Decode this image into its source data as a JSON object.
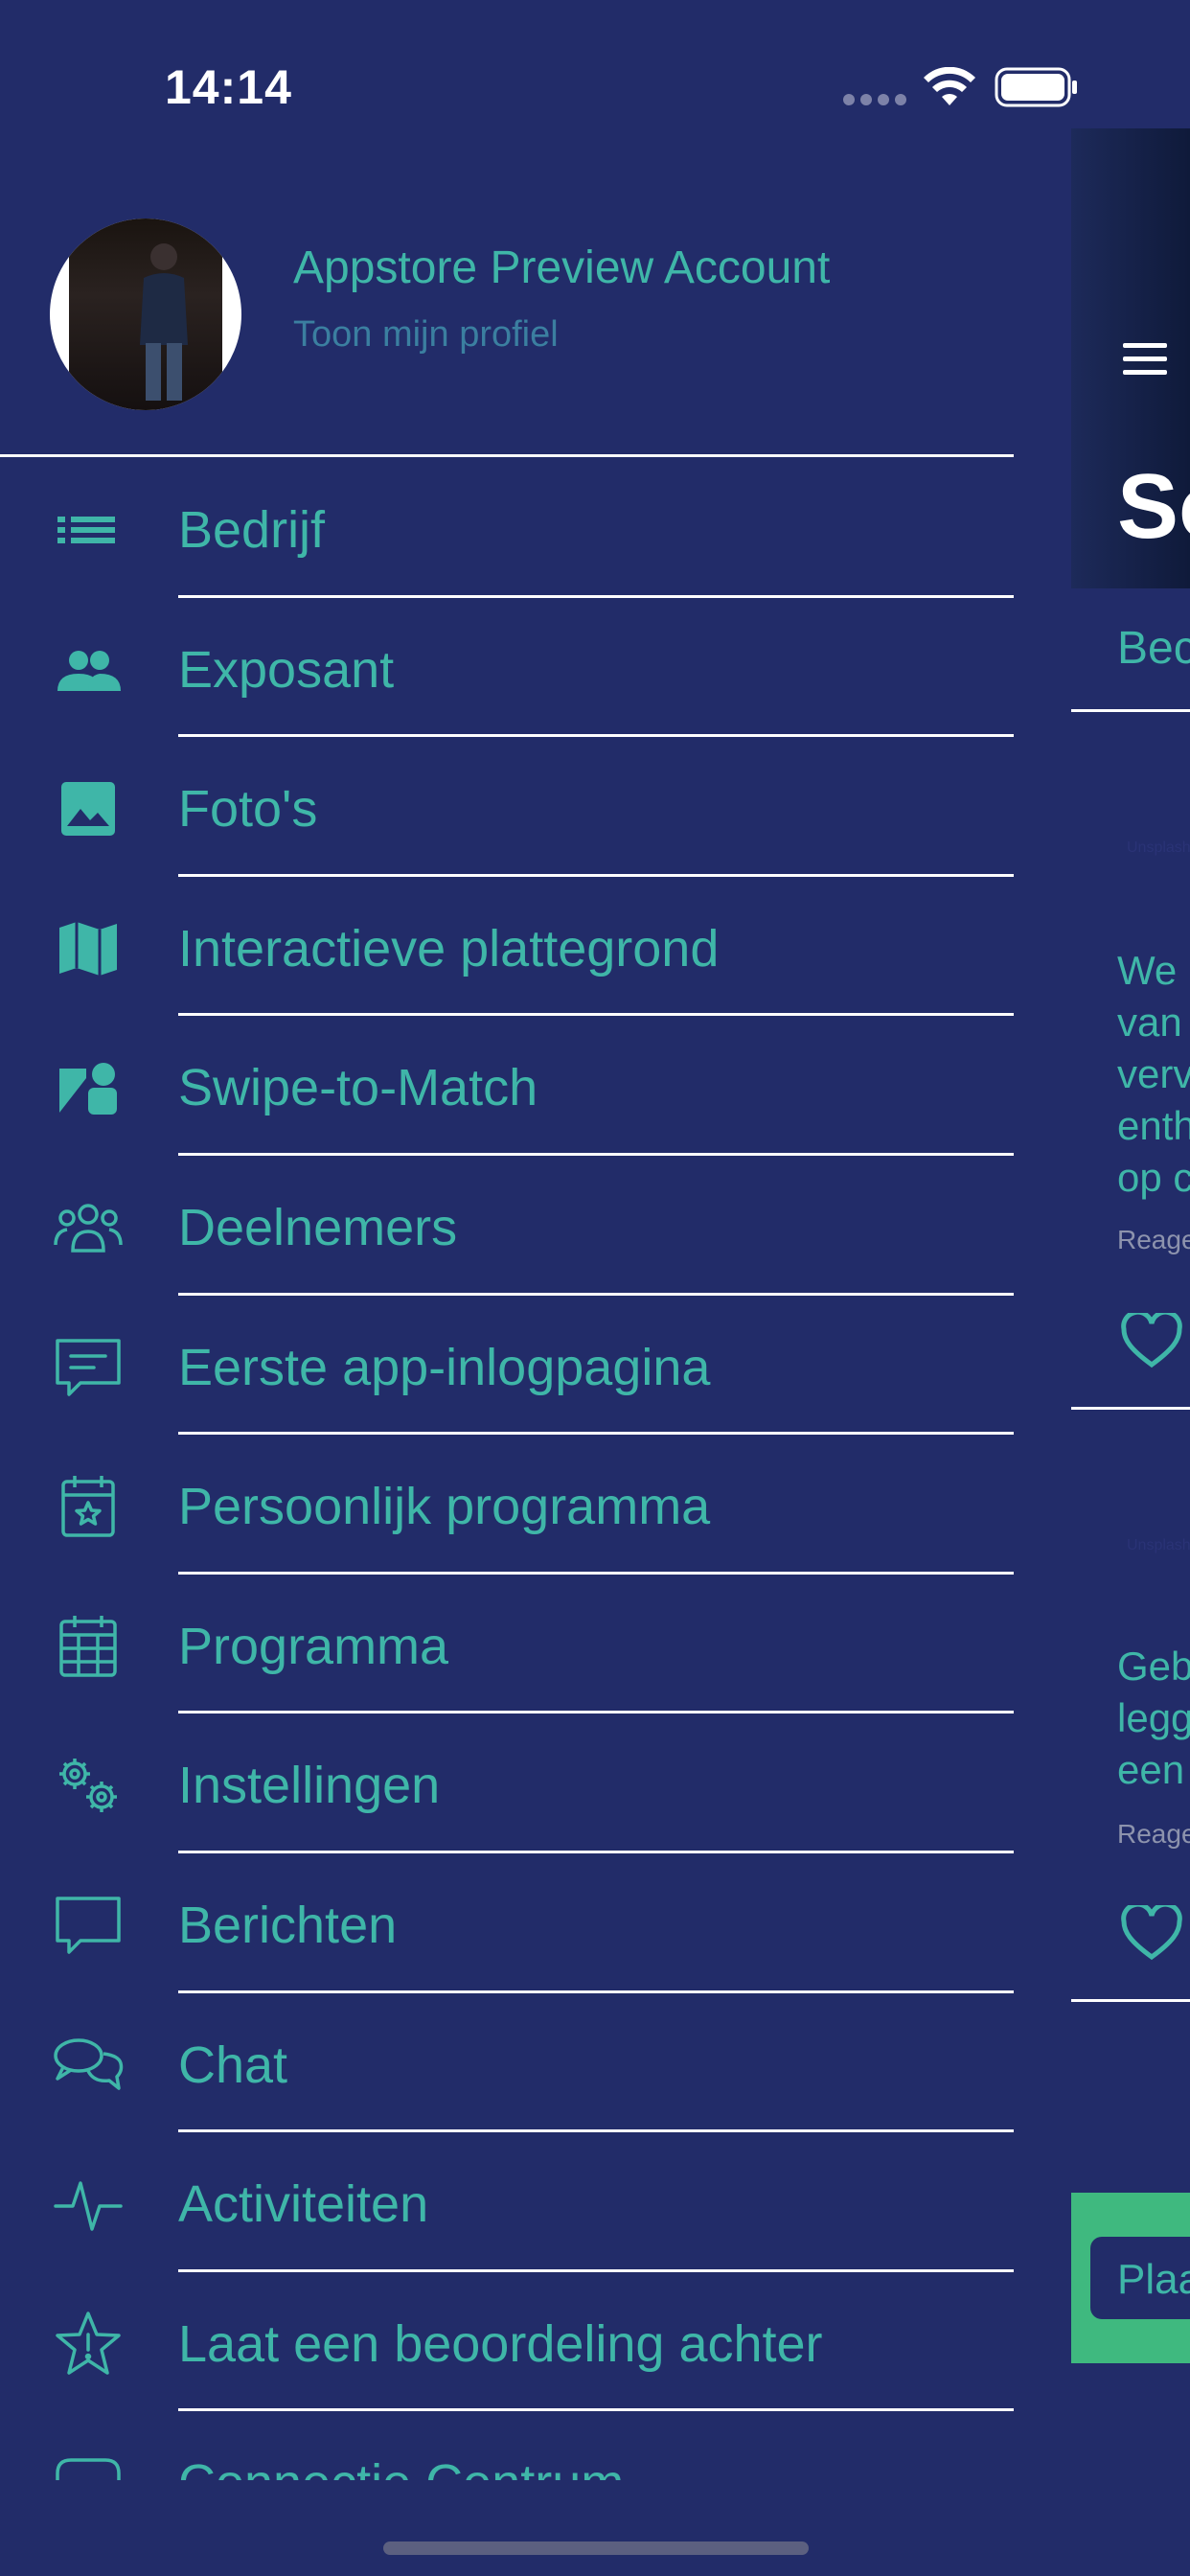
{
  "status_bar": {
    "time": "14:14"
  },
  "profile": {
    "name": "Appstore Preview Account",
    "subtitle": "Toon mijn profiel"
  },
  "menu": [
    {
      "label": "Bedrijf",
      "icon": "list-icon"
    },
    {
      "label": "Exposant",
      "icon": "people-icon"
    },
    {
      "label": "Foto's",
      "icon": "image-icon"
    },
    {
      "label": "Interactieve plattegrond",
      "icon": "map-icon"
    },
    {
      "label": "Swipe-to-Match",
      "icon": "shapes-icon"
    },
    {
      "label": "Deelnemers",
      "icon": "group-icon"
    },
    {
      "label": "Eerste app-inlogpagina",
      "icon": "chat-text-icon"
    },
    {
      "label": "Persoonlijk programma",
      "icon": "calendar-star-icon"
    },
    {
      "label": "Programma",
      "icon": "calendar-grid-icon"
    },
    {
      "label": "Instellingen",
      "icon": "gears-icon"
    },
    {
      "label": "Berichten",
      "icon": "message-square-icon"
    },
    {
      "label": "Chat",
      "icon": "chat-bubbles-icon"
    },
    {
      "label": "Activiteiten",
      "icon": "activity-pulse-icon"
    },
    {
      "label": "Laat een beoordeling achter",
      "icon": "star-alert-icon"
    },
    {
      "label": "Connectie Centrum",
      "icon": "connection-icon"
    }
  ],
  "peek": {
    "title": "So",
    "tab": "Bec",
    "post1_text": "We \nvan \nverv\nenth\nop c",
    "post1_meta": "Reage",
    "post2_text": "Geb\nlegg\neen",
    "post2_meta": "Reage",
    "image_placeholder": "Unsplash",
    "button": "Plaa"
  },
  "colors": {
    "background": "#222c69",
    "accent": "#3fb6a8",
    "green_bar": "#3fb97f",
    "divider": "#ffffff"
  }
}
